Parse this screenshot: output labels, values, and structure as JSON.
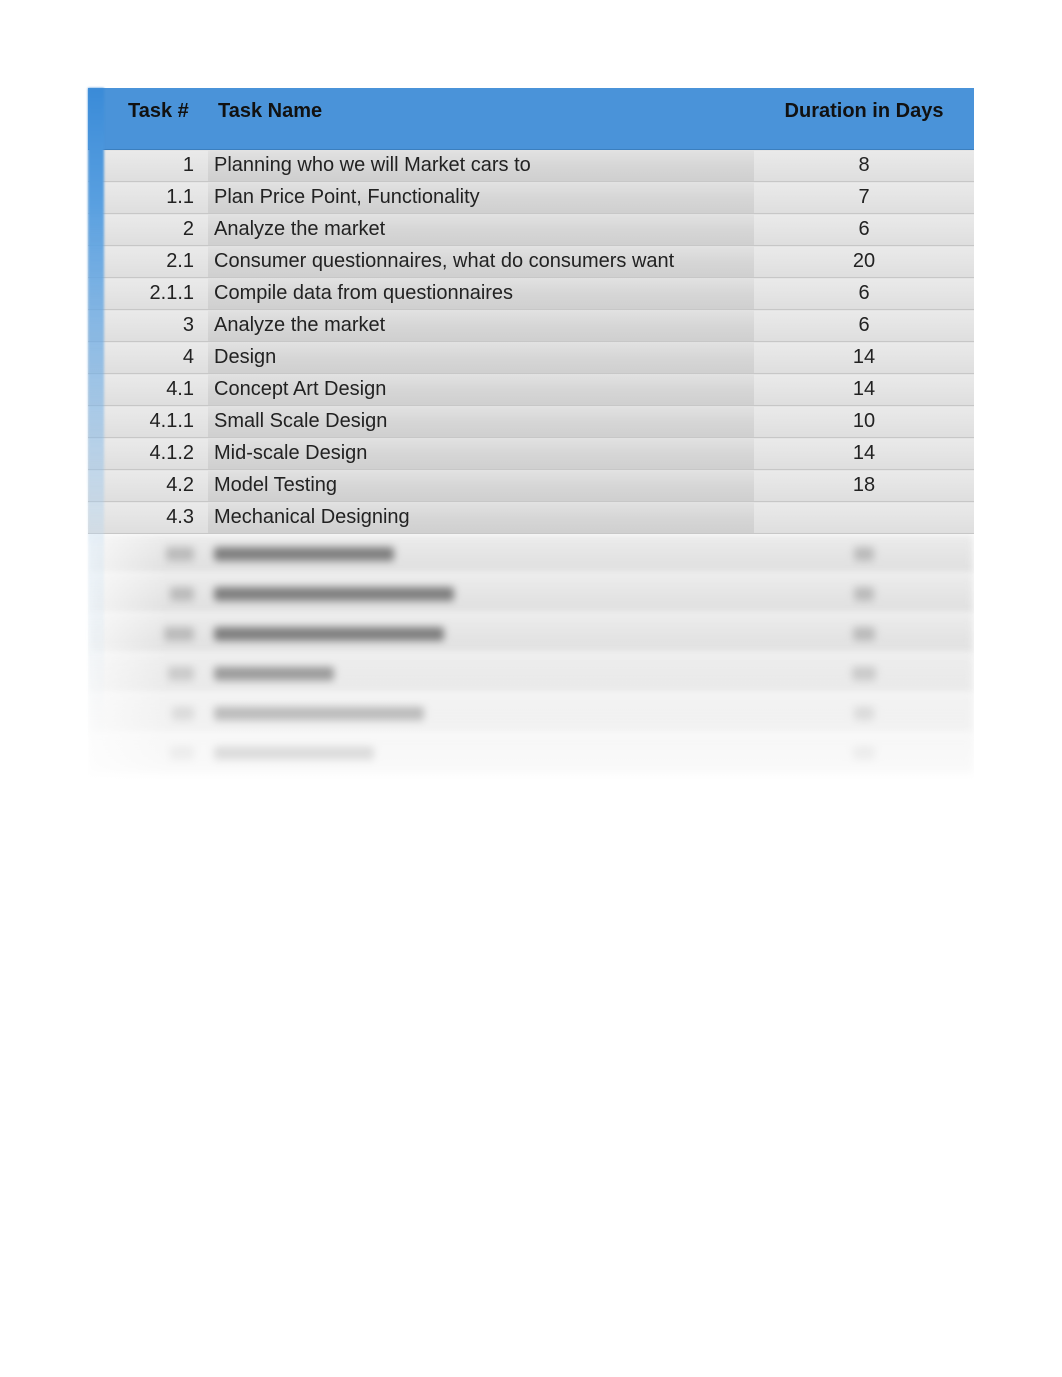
{
  "chart_data": {
    "type": "table",
    "headers": [
      "Task #",
      "Task Name",
      "Duration in Days"
    ],
    "rows": [
      {
        "task_num": "1",
        "task_name": "Planning who we will Market cars to",
        "duration": "8"
      },
      {
        "task_num": "1.1",
        "task_name": "Plan Price Point, Functionality",
        "duration": "7"
      },
      {
        "task_num": "2",
        "task_name": "Analyze the market",
        "duration": "6"
      },
      {
        "task_num": "2.1",
        "task_name": "Consumer questionnaires, what do consumers want",
        "duration": "20"
      },
      {
        "task_num": "2.1.1",
        "task_name": "Compile data from questionnaires",
        "duration": "6"
      },
      {
        "task_num": "3",
        "task_name": "Analyze the market",
        "duration": "6"
      },
      {
        "task_num": "4",
        "task_name": "Design",
        "duration": "14"
      },
      {
        "task_num": "4.1",
        "task_name": "Concept Art Design",
        "duration": "14"
      },
      {
        "task_num": "4.1.1",
        "task_name": "Small Scale Design",
        "duration": "10"
      },
      {
        "task_num": "4.1.2",
        "task_name": "Mid-scale Design",
        "duration": "14"
      },
      {
        "task_num": "4.2",
        "task_name": "Model Testing",
        "duration": "18"
      },
      {
        "task_num": "4.3",
        "task_name": "Mechanical Designing",
        "duration": ""
      }
    ]
  },
  "columns": {
    "task_num": "Task #",
    "task_name": "Task Name",
    "duration": "Duration in Days"
  },
  "rows": [
    {
      "task_num": "1",
      "task_name": "Planning who we will Market cars to",
      "duration": "8"
    },
    {
      "task_num": "1.1",
      "task_name": "Plan Price Point, Functionality",
      "duration": "7"
    },
    {
      "task_num": "2",
      "task_name": "Analyze the market",
      "duration": "6"
    },
    {
      "task_num": "2.1",
      "task_name": "Consumer questionnaires, what do consumers want",
      "duration": "20"
    },
    {
      "task_num": "2.1.1",
      "task_name": "Compile data from questionnaires",
      "duration": "6"
    },
    {
      "task_num": "3",
      "task_name": "Analyze the market",
      "duration": "6"
    },
    {
      "task_num": "4",
      "task_name": "Design",
      "duration": "14"
    },
    {
      "task_num": "4.1",
      "task_name": "Concept Art Design",
      "duration": "14"
    },
    {
      "task_num": "4.1.1",
      "task_name": "Small Scale Design",
      "duration": "10"
    },
    {
      "task_num": "4.1.2",
      "task_name": "Mid-scale Design",
      "duration": "14"
    },
    {
      "task_num": "4.2",
      "task_name": "Model Testing",
      "duration": "18"
    },
    {
      "task_num": "4.3",
      "task_name": "Mechanical Designing",
      "duration": ""
    }
  ],
  "colors": {
    "header_bg": "#4a93d9",
    "row_bg": "#dcdcdc"
  }
}
